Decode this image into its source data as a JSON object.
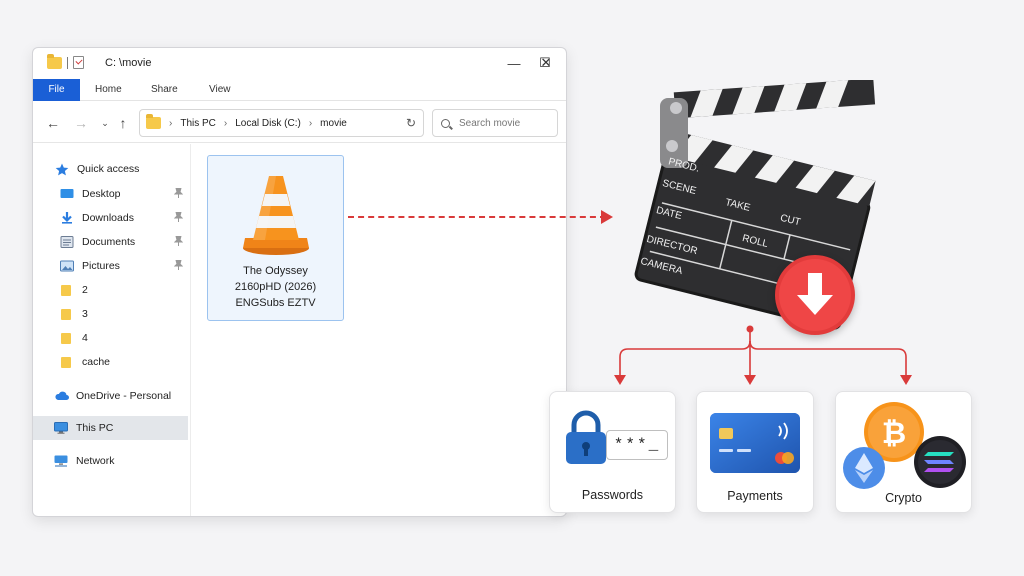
{
  "window": {
    "title": "C: \\movie",
    "controls": {
      "minimize": "—",
      "maximize": "☐",
      "close": "✕"
    }
  },
  "ribbon": {
    "tabs": [
      "File",
      "Home",
      "Share",
      "View"
    ]
  },
  "navigation": {
    "address": [
      "This PC",
      "Local Disk (C:)",
      "movie"
    ],
    "search_placeholder": "Search movie"
  },
  "sidebar": {
    "items": [
      {
        "label": "Quick access",
        "icon": "star-icon"
      },
      {
        "label": "Desktop",
        "icon": "desktop-icon",
        "pinned": true
      },
      {
        "label": "Downloads",
        "icon": "download-arrow-icon",
        "pinned": true
      },
      {
        "label": "Documents",
        "icon": "documents-icon",
        "pinned": true
      },
      {
        "label": "Pictures",
        "icon": "pictures-icon",
        "pinned": true
      },
      {
        "label": "2",
        "icon": "folder-icon"
      },
      {
        "label": "3",
        "icon": "folder-icon"
      },
      {
        "label": "4",
        "icon": "folder-icon"
      },
      {
        "label": "cache",
        "icon": "folder-icon"
      },
      {
        "label": "OneDrive - Personal",
        "icon": "cloud-icon"
      },
      {
        "label": "This PC",
        "icon": "monitor-icon",
        "selected": true
      },
      {
        "label": "Network",
        "icon": "network-icon"
      }
    ]
  },
  "file": {
    "name_lines": [
      "The Odyssey",
      "2160pHD (2026)",
      "ENGSubs EZTV"
    ],
    "icon": "vlc-cone-icon"
  },
  "clapperboard": {
    "labels": [
      "PROD.",
      "SCENE",
      "TAKE",
      "CUT",
      "DATE",
      "ROLL",
      "DIRECTOR",
      "CAMERA"
    ],
    "badge_icon": "download-arrow-icon"
  },
  "cards": [
    {
      "label": "Passwords",
      "icon": "padlock-icon",
      "field_text": "***_"
    },
    {
      "label": "Payments",
      "icon": "credit-card-icon"
    },
    {
      "label": "Crypto",
      "icon": "crypto-coins-icon"
    }
  ],
  "colors": {
    "accent_red": "#d93a3a",
    "file_tab_blue": "#1a5fd6",
    "folder_yellow": "#f6c94a"
  }
}
